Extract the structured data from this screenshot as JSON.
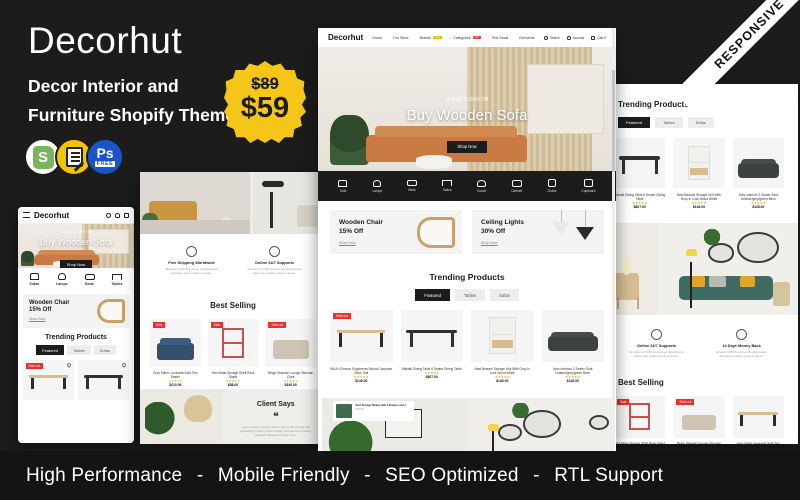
{
  "promo": {
    "brand": "Decorhut",
    "tagline_line1": "Decor Interior and",
    "tagline_line2": "Furniture  Shopify Theme",
    "old_price": "$89",
    "new_price": "$59",
    "ribbon": "RESPONSIVE",
    "badges": [
      {
        "name": "shopify-badge",
        "label": "S"
      },
      {
        "name": "documentation-badge",
        "label": ""
      },
      {
        "name": "photoshop-badge",
        "label": "Ps",
        "sub": "FREE"
      }
    ],
    "features": [
      "High Performance",
      "Mobile Friendly",
      "SEO Optimized",
      "RTL Support"
    ],
    "feature_separator": "-"
  },
  "site": {
    "logo": "Decorhut",
    "nav": [
      "Home",
      "Our Store",
      "Brands",
      "Categories",
      "Test Deals",
      "Elements"
    ],
    "nav_badges": {
      "brands": "New",
      "categories": "Hot"
    },
    "account_actions": [
      "Search",
      "Account",
      "Cart 0"
    ],
    "hero": {
      "eyebrow": "Get Up To 50% Off",
      "title": "Buy Wooden Sofa",
      "cta": "Shop Now"
    },
    "categories": [
      "Sofa",
      "Lamps",
      "Beds",
      "Tables",
      "Couch",
      "Cabinet",
      "Chairs",
      "Cupboard"
    ],
    "categories_mobile": [
      "Sofas",
      "Lamps",
      "Beds",
      "Tables"
    ],
    "promos": [
      {
        "title": "Wooden Chair",
        "subtitle": "15% Off",
        "link": "Shop Now"
      },
      {
        "title": "Ceiling Lights",
        "subtitle": "30% Off",
        "link": "Shop Now"
      }
    ],
    "trending": {
      "heading": "Trending Products",
      "tabs": [
        "Featured",
        "Tables",
        "Sofas"
      ],
      "active_tab": "Featured",
      "products": [
        {
          "name": "MILA 4-Person Engineered Wood Computer Desk Teal",
          "rating": "★★★★★",
          "reviews": "(0)",
          "price": "$149.00",
          "badge": "Sold out"
        },
        {
          "name": "Makalti Dining Table 6 Seater Dining Table",
          "rating": "★★★★★",
          "reviews": "(0)",
          "price": "$807.00",
          "badge": ""
        },
        {
          "name": "Nest Beaumi Storage Unit With Drop In Lock Wood White",
          "rating": "★★★★★",
          "reviews": "(0)",
          "price": "$136.00",
          "badge": ""
        },
        {
          "name": "Ares Interiors 3 Seater Sofa Leather/grey/green Birch",
          "rating": "★★★★★",
          "reviews": "(0)",
          "price": "$128.00",
          "badge": ""
        }
      ]
    },
    "services": [
      {
        "title": "Free Shipping Worldwide",
        "desc": "Aliquam sit BOS in amet mingitat ante previous amet neque a quote."
      },
      {
        "title": "Online 24/7 Supports",
        "desc": "Ac lorem 47/100 sit amet at dignits bore dorec ase prolin neque a quote."
      },
      {
        "title": "14 Days Money Back",
        "desc": "Erveen of BOS a nove chingtia bolon ardouncey ordet neque a quote."
      }
    ],
    "best_selling": {
      "heading": "Best Selling",
      "products": [
        {
          "name": "Grey Fabric Loveseat Sofa Two Seater",
          "price": "$210.00",
          "badge": "Sale"
        },
        {
          "name": "Red Metal Storage Shelf Rack Stand",
          "price": "$88.00",
          "badge": "Sale"
        },
        {
          "name": "Beige Modular Lounge Ottoman Chair",
          "price": "$340.00",
          "badge": "Sold out"
        }
      ]
    },
    "testimonial": {
      "heading": "Client Says",
      "quote_mark": "❝",
      "body": "Lorem ipsum is simply dummy text of the printing and typesetting industry. Lorem ipsum has been the industry standard dummy text ever since."
    },
    "lookbook_card": {
      "title": "Nest Storage Tabinet with 2 Drawers and 2",
      "meta": "$139.00"
    }
  }
}
